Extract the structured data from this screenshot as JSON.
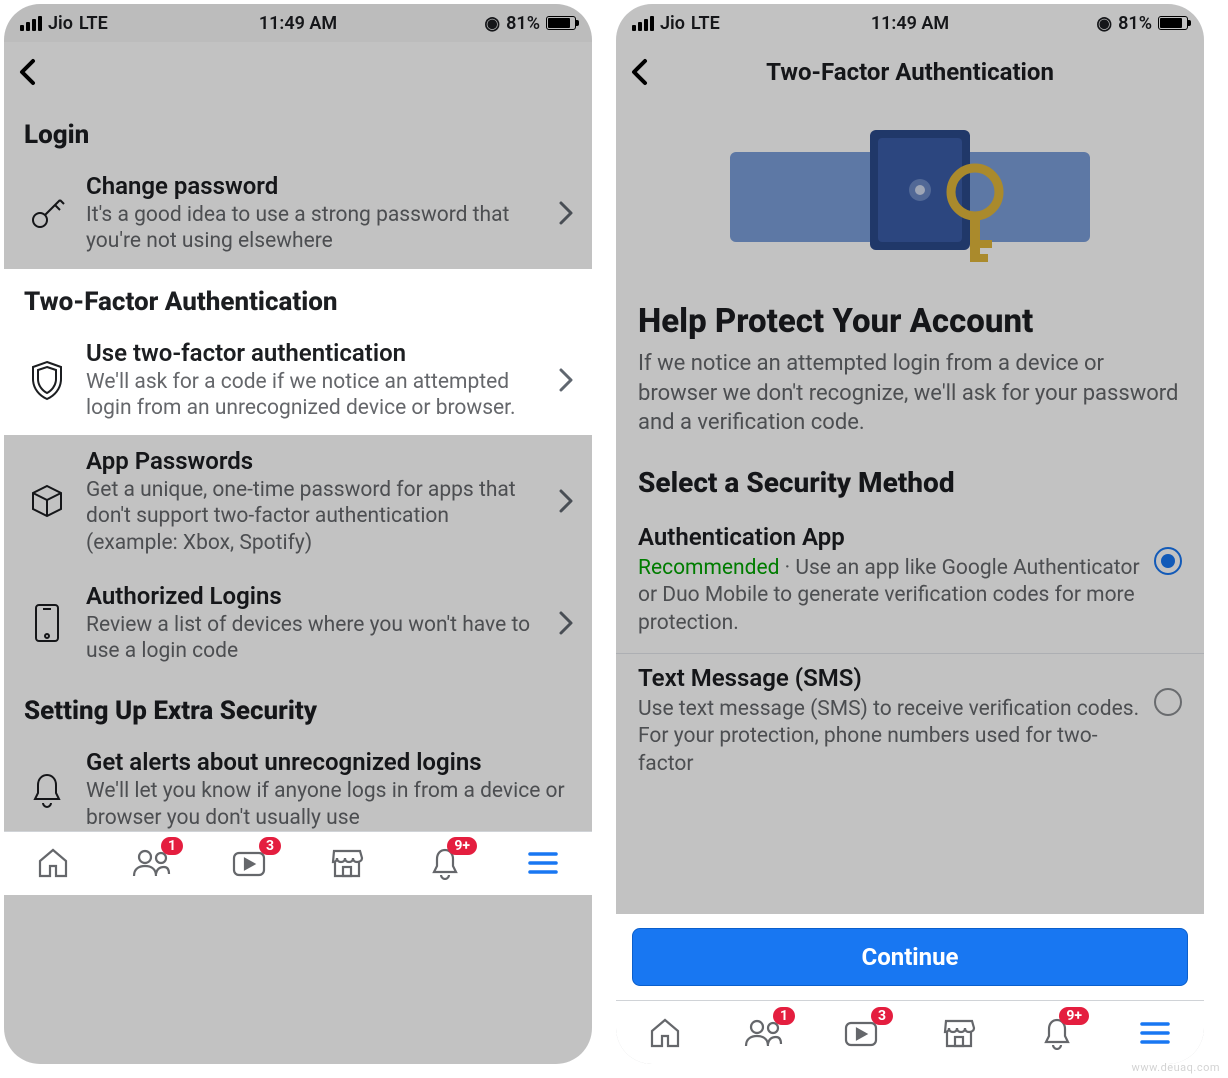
{
  "status_bar": {
    "carrier": "Jio",
    "network": "LTE",
    "time": "11:49 AM",
    "battery_percent": "81%",
    "location_icon": "location-icon"
  },
  "left": {
    "sections": {
      "login": {
        "header": "Login",
        "change_password": {
          "title": "Change password",
          "sub": "It's a good idea to use a strong password that you're not using elsewhere"
        }
      },
      "tfa": {
        "header": "Two-Factor Authentication",
        "use_tfa": {
          "title": "Use two-factor authentication",
          "sub": "We'll ask for a code if we notice an attempted login from an unrecognized device or browser."
        },
        "app_passwords": {
          "title": "App Passwords",
          "sub": "Get a unique, one-time password for apps that don't support two-factor authentication (example: Xbox, Spotify)"
        },
        "authorized_logins": {
          "title": "Authorized Logins",
          "sub": "Review a list of devices where you won't have to use a login code"
        }
      },
      "extra": {
        "header": "Setting Up Extra Security",
        "alerts": {
          "title": "Get alerts about unrecognized logins",
          "sub": "We'll let you know if anyone logs in from a device or browser you don't usually use"
        }
      }
    }
  },
  "right": {
    "header_title": "Two-Factor Authentication",
    "big_title": "Help Protect Your Account",
    "desc": "If we notice an attempted login from a device or browser we don't recognize, we'll ask for your password and a verification code.",
    "method_header": "Select a Security Method",
    "methods": {
      "auth_app": {
        "title": "Authentication App",
        "recommended": "Recommended",
        "sub": " · Use an app like Google Authenticator or Duo Mobile to generate verification codes for more protection.",
        "selected": true
      },
      "sms": {
        "title": "Text Message (SMS)",
        "sub": "Use text message (SMS) to receive verification codes. For your protection, phone numbers used for two-factor",
        "selected": false
      }
    },
    "continue_label": "Continue"
  },
  "tabs": {
    "friends_badge": "1",
    "watch_badge": "3",
    "notifications_badge": "9+"
  },
  "watermark": "www.deuaq.com"
}
